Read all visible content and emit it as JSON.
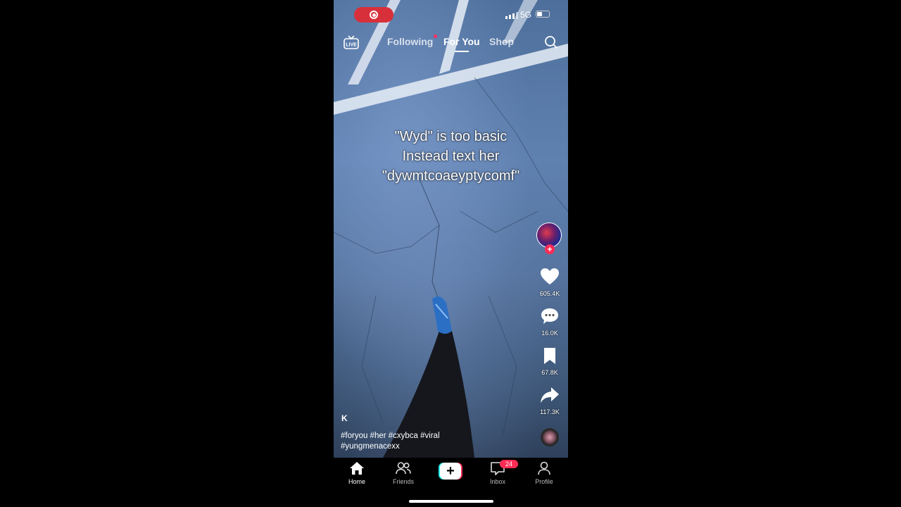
{
  "status_bar": {
    "network": "5G"
  },
  "top_nav": {
    "live_label": "LIVE",
    "tabs": [
      {
        "label": "Following"
      },
      {
        "label": "For You"
      },
      {
        "label": "Shop"
      }
    ]
  },
  "video": {
    "caption_lines": [
      "\"Wyd\" is too basic",
      "Instead text her",
      "\"dywmtcoaeyptycomf\""
    ],
    "username": "K",
    "description_line1": "#foryou #her #cxybca #viral",
    "description_line2": "#yungmenacexx"
  },
  "actions": {
    "likes": "605.4K",
    "comments": "16.0K",
    "saves": "67.8K",
    "shares": "117.3K"
  },
  "bottom_nav": {
    "home": "Home",
    "friends": "Friends",
    "inbox": "Inbox",
    "inbox_badge": "24",
    "profile": "Profile"
  },
  "colors": {
    "accent": "#fe2c55",
    "cyan": "#25f4ee",
    "record": "#d8303a"
  }
}
